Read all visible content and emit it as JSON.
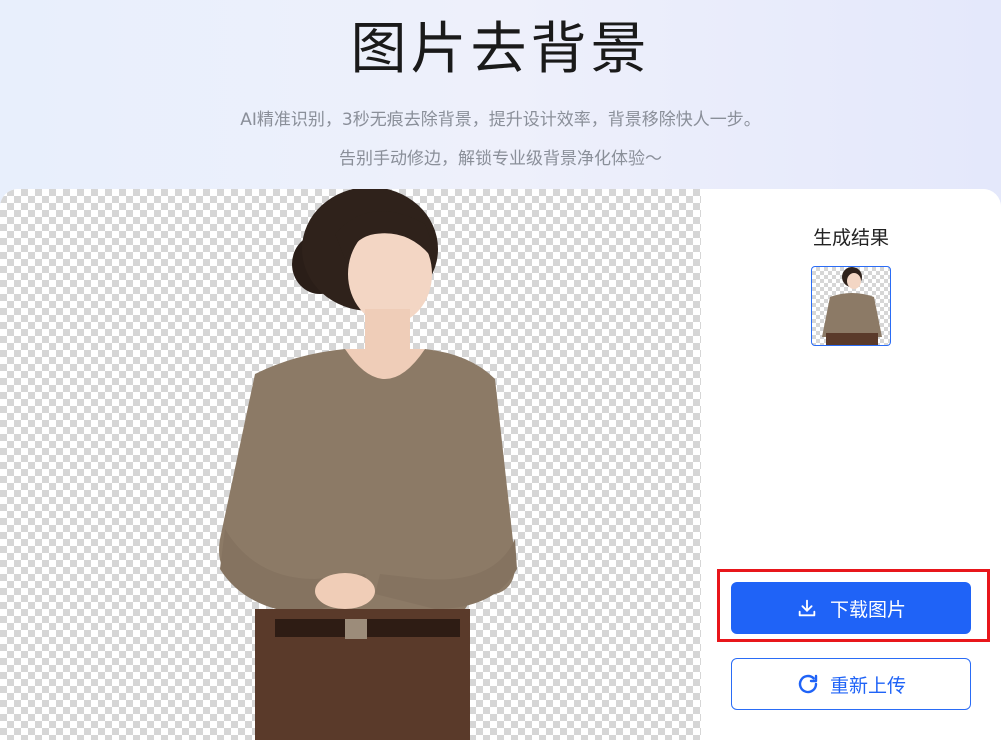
{
  "hero": {
    "title": "图片去背景",
    "subtitle_line1": "AI精准识别，3秒无痕去除背景，提升设计效率，背景移除快人一步。",
    "subtitle_line2": "告别手动修边，解锁专业级背景净化体验～"
  },
  "result_panel": {
    "label": "生成结果",
    "download_label": "下载图片",
    "reupload_label": "重新上传"
  },
  "icons": {
    "download": "download-icon",
    "reupload": "refresh-icon"
  },
  "colors": {
    "primary": "#1f63f7",
    "highlight_border": "#e8161b",
    "sweater": "#8c7a66",
    "pants": "#5a3a2a"
  }
}
